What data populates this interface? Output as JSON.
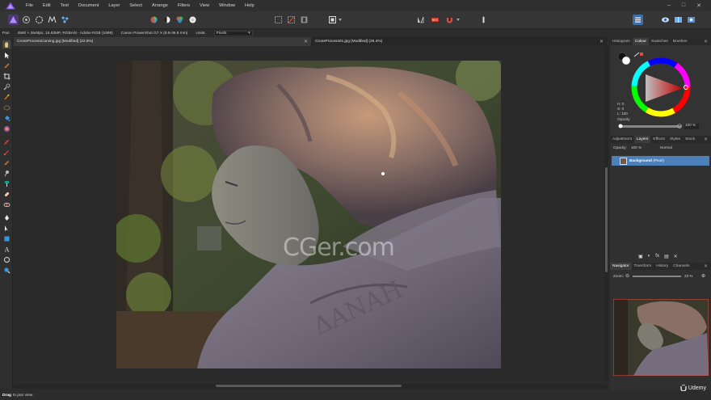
{
  "menu": {
    "items": [
      "File",
      "Edit",
      "Text",
      "Document",
      "Layer",
      "Select",
      "Arrange",
      "Filters",
      "View",
      "Window",
      "Help"
    ]
  },
  "context_bar": {
    "tool_name": "Pan",
    "image_info": "4560 × 3648px, 16.63MP, RGBA/8 - Adobe RGB (1998)",
    "camera": "Canon PowerShot G7 X (8.8-36.8 mm)",
    "units_label": "Units:",
    "units_value": "Pixels"
  },
  "documents": {
    "tabs": [
      {
        "label": "CrossProcessCarving.jpg [Modified] (22.8%)"
      },
      {
        "label": "CrossProcess01.jpg [Modified] (26.4%)"
      }
    ]
  },
  "canvas": {
    "watermark": "CGer.com"
  },
  "colour_panel": {
    "tabs": [
      "Histogram",
      "Colour",
      "Swatches",
      "Brushes"
    ],
    "active_tab": "Colour",
    "h_label": "H: 0",
    "s_label": "S: 0",
    "l_label": "L: 100",
    "opacity_label": "Opacity",
    "opacity_value": "100 %"
  },
  "layers_panel": {
    "tabs": [
      "Adjustment",
      "Layers",
      "Effects",
      "Styles",
      "Stock"
    ],
    "active_tab": "Layers",
    "opacity_label": "Opacity:",
    "opacity_value": "100 %",
    "blend_mode": "Normal",
    "layers": [
      {
        "name": "Background",
        "type": "(Pixel)"
      }
    ]
  },
  "navigator_panel": {
    "tabs": [
      "Navigator",
      "Transform",
      "History",
      "Channels"
    ],
    "active_tab": "Navigator",
    "zoom_label": "Zoom:",
    "zoom_value": "23 %"
  },
  "status": {
    "action": "Drag",
    "hint": "to pan view."
  },
  "branding": {
    "udemy": "Udemy"
  },
  "colors": {
    "selection_blue": "#4d7fb8",
    "panel_bg": "#303030",
    "app_purple": "#7a4fd6"
  }
}
